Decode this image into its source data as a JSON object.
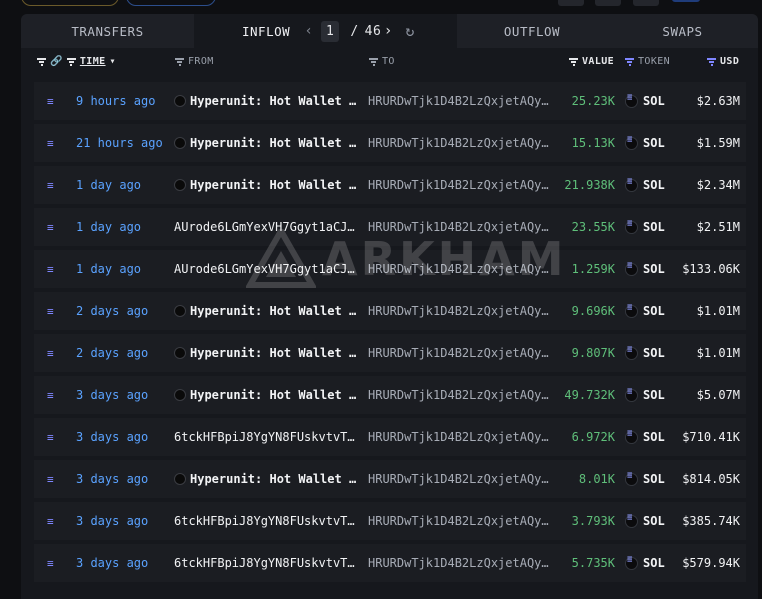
{
  "tabs": {
    "transfers": "TRANSFERS",
    "inflow": "INFLOW",
    "outflow": "OUTFLOW",
    "swaps": "SWAPS"
  },
  "pager": {
    "current": "1",
    "separator": "/",
    "total": "46"
  },
  "columns": {
    "time": "TIME",
    "from": "FROM",
    "to": "TO",
    "value": "VALUE",
    "token": "TOKEN",
    "usd": "USD"
  },
  "watermark": "ARKHAM",
  "rows": [
    {
      "time": "9 hours ago",
      "from": "Hyperunit: Hot Wallet (...",
      "from_entity": true,
      "to": "HRURDwTjk1D4B2LzQxjetAQy...",
      "value": "25.23K",
      "token": "SOL",
      "usd": "$2.63M"
    },
    {
      "time": "21 hours ago",
      "from": "Hyperunit: Hot Wallet (...",
      "from_entity": true,
      "to": "HRURDwTjk1D4B2LzQxjetAQy...",
      "value": "15.13K",
      "token": "SOL",
      "usd": "$1.59M"
    },
    {
      "time": "1 day ago",
      "from": "Hyperunit: Hot Wallet (...",
      "from_entity": true,
      "to": "HRURDwTjk1D4B2LzQxjetAQy...",
      "value": "21.938K",
      "token": "SOL",
      "usd": "$2.34M"
    },
    {
      "time": "1 day ago",
      "from": "AUrode6LGmYexVH7Ggyt1aCJ...",
      "from_entity": false,
      "to": "HRURDwTjk1D4B2LzQxjetAQy...",
      "value": "23.55K",
      "token": "SOL",
      "usd": "$2.51M"
    },
    {
      "time": "1 day ago",
      "from": "AUrode6LGmYexVH7Ggyt1aCJ...",
      "from_entity": false,
      "to": "HRURDwTjk1D4B2LzQxjetAQy...",
      "value": "1.259K",
      "token": "SOL",
      "usd": "$133.06K"
    },
    {
      "time": "2 days ago",
      "from": "Hyperunit: Hot Wallet (...",
      "from_entity": true,
      "to": "HRURDwTjk1D4B2LzQxjetAQy...",
      "value": "9.696K",
      "token": "SOL",
      "usd": "$1.01M"
    },
    {
      "time": "2 days ago",
      "from": "Hyperunit: Hot Wallet (...",
      "from_entity": true,
      "to": "HRURDwTjk1D4B2LzQxjetAQy...",
      "value": "9.807K",
      "token": "SOL",
      "usd": "$1.01M"
    },
    {
      "time": "3 days ago",
      "from": "Hyperunit: Hot Wallet (...",
      "from_entity": true,
      "to": "HRURDwTjk1D4B2LzQxjetAQy...",
      "value": "49.732K",
      "token": "SOL",
      "usd": "$5.07M"
    },
    {
      "time": "3 days ago",
      "from": "6tckHFBpiJ8YgYN8FUskvtvT...",
      "from_entity": false,
      "to": "HRURDwTjk1D4B2LzQxjetAQy...",
      "value": "6.972K",
      "token": "SOL",
      "usd": "$710.41K"
    },
    {
      "time": "3 days ago",
      "from": "Hyperunit: Hot Wallet (...",
      "from_entity": true,
      "to": "HRURDwTjk1D4B2LzQxjetAQy...",
      "value": "8.01K",
      "token": "SOL",
      "usd": "$814.05K"
    },
    {
      "time": "3 days ago",
      "from": "6tckHFBpiJ8YgYN8FUskvtvT...",
      "from_entity": false,
      "to": "HRURDwTjk1D4B2LzQxjetAQy...",
      "value": "3.793K",
      "token": "SOL",
      "usd": "$385.74K"
    },
    {
      "time": "3 days ago",
      "from": "6tckHFBpiJ8YgYN8FUskvtvT...",
      "from_entity": false,
      "to": "HRURDwTjk1D4B2LzQxjetAQy...",
      "value": "5.735K",
      "token": "SOL",
      "usd": "$579.94K"
    }
  ]
}
